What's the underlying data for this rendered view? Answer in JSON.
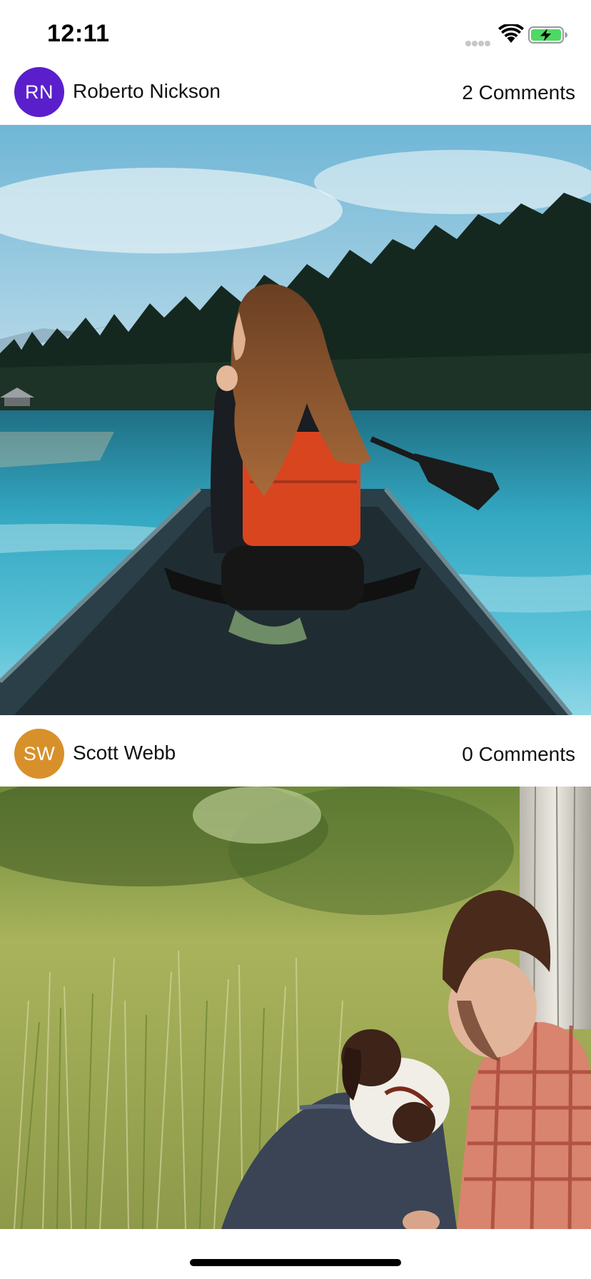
{
  "status_bar": {
    "time": "12:11",
    "battery_state": "charging",
    "battery_color": "#4cd964"
  },
  "posts": [
    {
      "author": "Roberto Nickson",
      "initials": "RN",
      "avatar_color": "#5a1fcb",
      "comments": "2 Comments",
      "photo_alt": "Woman with long hair paddling a canoe on a turquoise lake with a pine forest behind"
    },
    {
      "author": "Scott Webb",
      "initials": "SW",
      "avatar_color": "#d8902a",
      "comments": "0 Comments",
      "photo_alt": "Man in plaid shirt sitting in tall grass with a brown and white dog"
    }
  ]
}
